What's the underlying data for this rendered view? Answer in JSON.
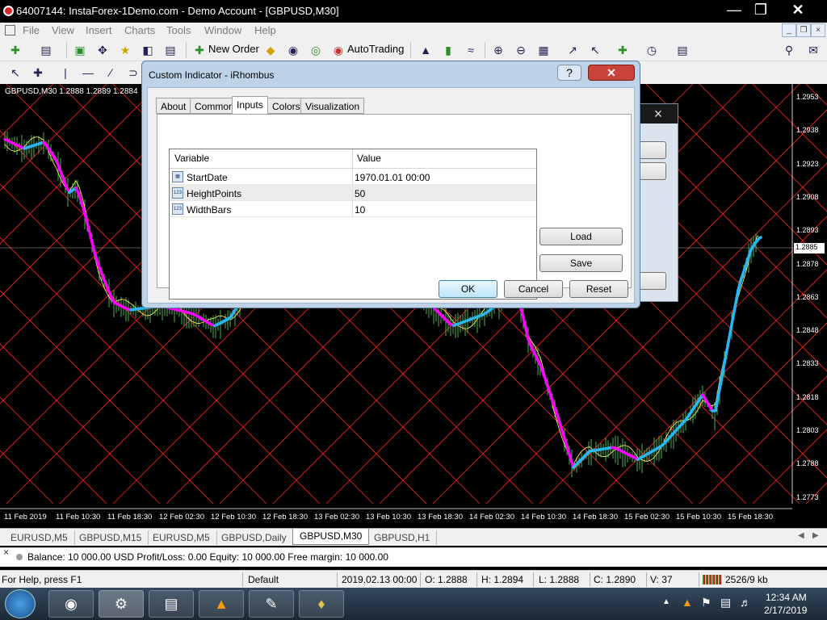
{
  "window": {
    "title": "64007144: InstaForex-1Demo.com - Demo Account - [GBPUSD,M30]",
    "minimize_icon": "minimize-icon",
    "maximize_icon": "maximize-icon",
    "close_icon": "close-icon"
  },
  "menu": [
    "File",
    "View",
    "Insert",
    "Charts",
    "Tools",
    "Window",
    "Help"
  ],
  "toolbar": {
    "new_order": "New Order",
    "auto_trading": "AutoTrading"
  },
  "chart": {
    "header": "GBPUSD,M30  1.2888 1.2889 1.2884",
    "current_price": "1.2885",
    "price_axis": [
      "1.2953",
      "1.2938",
      "1.2923",
      "1.2908",
      "1.2893",
      "1.2878",
      "1.2863",
      "1.2848",
      "1.2833",
      "1.2818",
      "1.2803",
      "1.2788",
      "1.2773"
    ],
    "time_axis": [
      "11 Feb 2019",
      "11 Feb 10:30",
      "11 Feb 18:30",
      "12 Feb 02:30",
      "12 Feb 10:30",
      "12 Feb 18:30",
      "13 Feb 02:30",
      "13 Feb 10:30",
      "13 Feb 18:30",
      "14 Feb 02:30",
      "14 Feb 10:30",
      "14 Feb 18:30",
      "15 Feb 02:30",
      "15 Feb 10:30",
      "15 Feb 18:30"
    ],
    "colors": {
      "grid": "#ff2020",
      "bars": "#4caf50",
      "up": "#29b6f6",
      "down": "#ff00ff",
      "flat": "#ffff00",
      "envelope": "#ffff66"
    }
  },
  "chart_tabs": [
    "EURUSD,M5",
    "GBPUSD,M15",
    "EURUSD,M5",
    "GBPUSD,Daily",
    "GBPUSD,M30",
    "GBPUSD,H1"
  ],
  "balance_line": "Balance: 10 000.00 USD  Profit/Loss: 0.00  Equity: 10 000.00  Free margin: 10 000.00",
  "status": {
    "help": "For Help, press F1",
    "profile": "Default",
    "datetime": "2019.02.13 00:00",
    "open": "O: 1.2888",
    "high": "H: 1.2894",
    "low": "L: 1.2888",
    "close": "C: 1.2890",
    "volume": "V: 37",
    "traffic": "2526/9 kb"
  },
  "taskbar": {
    "time": "12:34 AM",
    "date": "2/17/2019"
  },
  "dialog": {
    "title": "Custom Indicator - iRhombus",
    "help_label": "?",
    "tabs": [
      "About",
      "Common",
      "Inputs",
      "Colors",
      "Visualization"
    ],
    "active_tab": "Inputs",
    "columns": [
      "Variable",
      "Value"
    ],
    "rows": [
      {
        "icon": "calendar-icon",
        "variable": "StartDate",
        "value": "1970.01.01 00:00"
      },
      {
        "icon": "number-icon",
        "variable": "HeightPoints",
        "value": "50"
      },
      {
        "icon": "number-icon",
        "variable": "WidthBars",
        "value": "10"
      }
    ],
    "load": "Load",
    "save": "Save",
    "ok": "OK",
    "cancel": "Cancel",
    "reset": "Reset"
  }
}
